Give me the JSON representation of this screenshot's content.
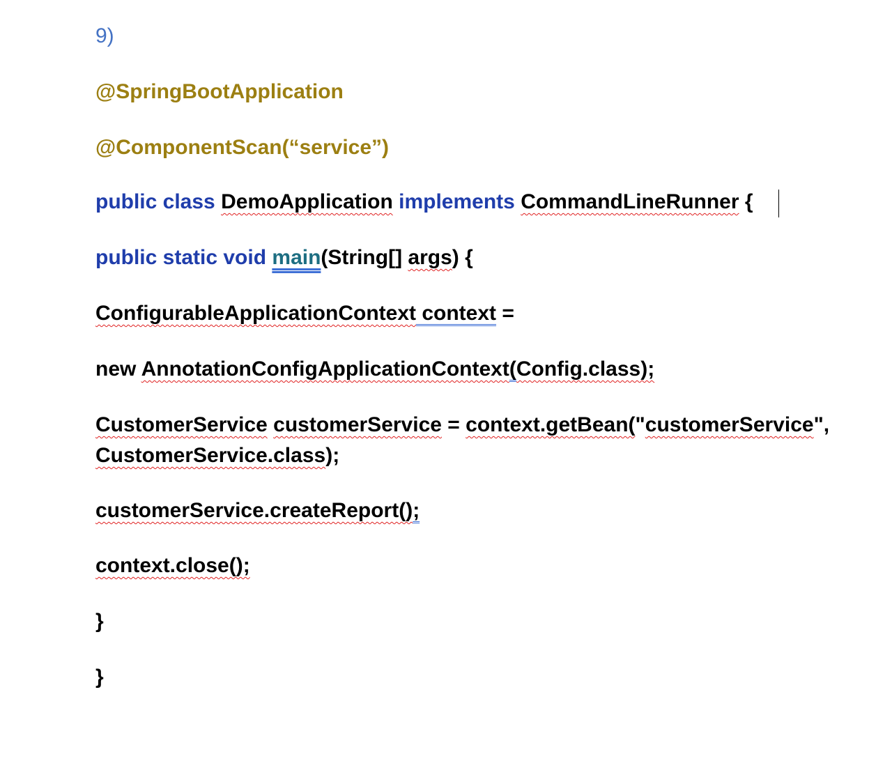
{
  "document": {
    "number_label": "9)",
    "annotation_1": "@SpringBootApplication",
    "annotation_2": "@ComponentScan(“service”)",
    "class_decl": {
      "kw_public_class": "public class",
      "class_name": "DemoApplication",
      "kw_implements": "implements",
      "interface_name": "CommandLineRunner",
      "brace": "{"
    },
    "main_decl": {
      "kw_modifiers": "public static void",
      "method_name": "main",
      "params_start": "(String[] ",
      "param_args": "args",
      "params_end": ") {"
    },
    "context_decl": {
      "type": "ConfigurableApplicationContext",
      "var": " context",
      "assign": " ="
    },
    "new_line": {
      "kw_new": "new ",
      "ctor": "AnnotationConfigApplicationContext",
      "paren": "(",
      "arg": "Config.class);"
    },
    "getbean_line": {
      "type": "CustomerService",
      "var": "customerService",
      "eq": " = ",
      "call": "context.getBean(",
      "quote_open": "\"",
      "bean_name": "customerService",
      "quote_close": "\",",
      "class_arg": "CustomerService.class",
      "end": ");"
    },
    "report_line": {
      "call": "customerService.createReport()",
      "end": ";"
    },
    "close_line": {
      "call": "context.close();"
    },
    "brace_close_1": "}",
    "brace_close_2": "}"
  }
}
